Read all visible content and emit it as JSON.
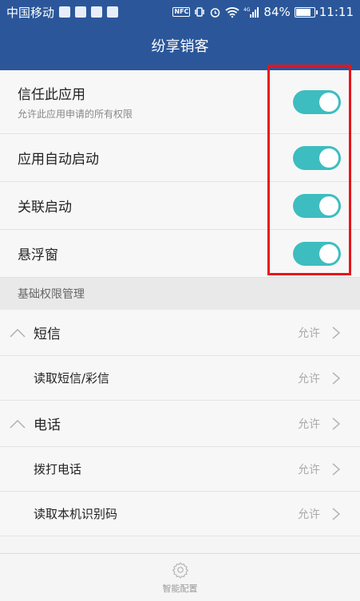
{
  "status_bar": {
    "carrier": "中国移动",
    "battery_text": "84%",
    "battery_level": 0.84,
    "time": "11:11",
    "network_label": "4G",
    "icons": [
      "nfc-icon",
      "vibrate-icon",
      "alarm-icon",
      "wifi-icon",
      "signal-icon",
      "battery-icon"
    ]
  },
  "header": {
    "title": "纷享销客"
  },
  "toggles": [
    {
      "label": "信任此应用",
      "sub": "允许此应用申请的所有权限",
      "on": true
    },
    {
      "label": "应用自动启动",
      "on": true
    },
    {
      "label": "关联启动",
      "on": true
    },
    {
      "label": "悬浮窗",
      "on": true
    }
  ],
  "section": {
    "title": "基础权限管理"
  },
  "permissions": [
    {
      "type": "group",
      "label": "短信",
      "status": "允许"
    },
    {
      "type": "item",
      "label": "读取短信/彩信",
      "status": "允许"
    },
    {
      "type": "group",
      "label": "电话",
      "status": "允许"
    },
    {
      "type": "item",
      "label": "拨打电话",
      "status": "允许"
    },
    {
      "type": "item",
      "label": "读取本机识别码",
      "status": "允许"
    }
  ],
  "bottom": {
    "label": "智能配置",
    "icon": "gear-icon"
  },
  "colors": {
    "header": "#2b579a",
    "switch_on": "#3dbdc0",
    "highlight": "#e8141b"
  }
}
